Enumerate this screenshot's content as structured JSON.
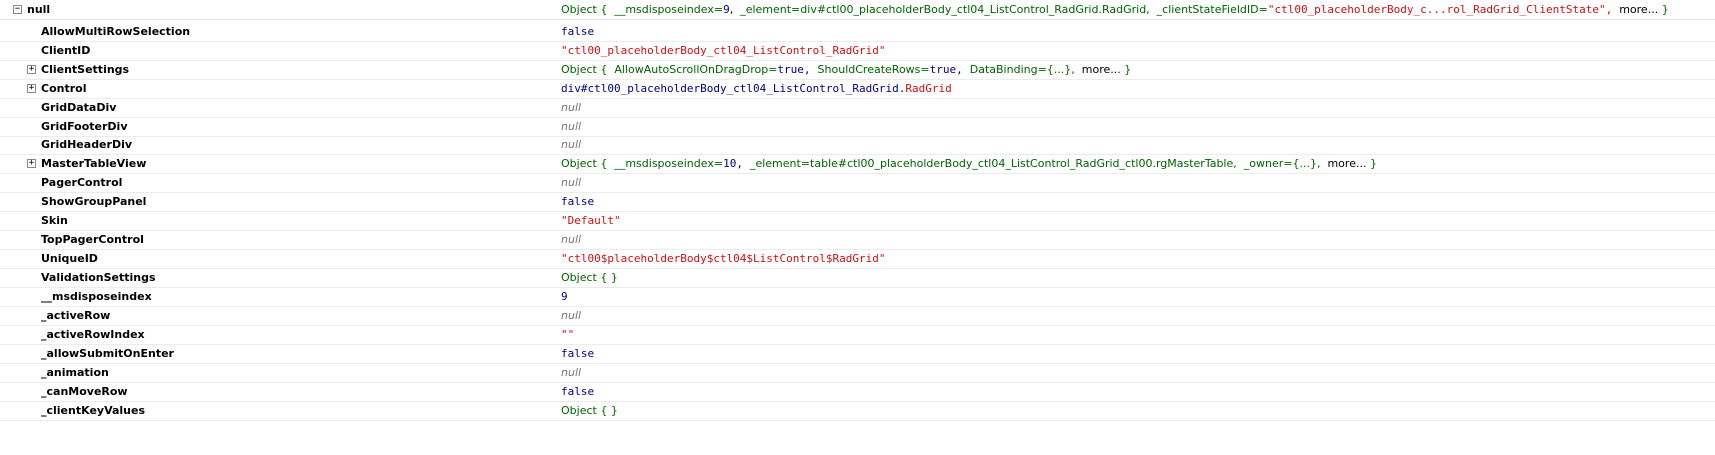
{
  "root": {
    "key": "null",
    "value": {
      "obj": "Object {",
      "p1": "__msdisposeindex=",
      "p1v": "9",
      "p2": "_element=div#ctl00_placeholderBody_ctl04_ListControl_RadGrid.RadGrid,",
      "p3": "_clientStateFieldID=",
      "p3v": "\"ctl00_placeholderBody_c...rol_RadGrid_ClientState\",",
      "more": "more...",
      "close": "}"
    }
  },
  "rows": [
    {
      "key": "AllowMultiRowSelection",
      "value": "false"
    },
    {
      "key": "ClientID",
      "value": "\"ctl00_placeholderBody_ctl04_ListControl_RadGrid\""
    },
    {
      "key": "ClientSettings",
      "value": {
        "obj": "Object {",
        "p1": "AllowAutoScrollOnDragDrop=",
        "p1v": "true,",
        "p2": "ShouldCreateRows=",
        "p2v": "true,",
        "p3": "DataBinding={...},",
        "more": "more...",
        "close": "}"
      }
    },
    {
      "key": "Control",
      "value": {
        "el": "div#ctl00_placeholderBody_ctl04_ListControl_RadGrid.",
        "cls": "RadGrid"
      }
    },
    {
      "key": "GridDataDiv",
      "value": "null"
    },
    {
      "key": "GridFooterDiv",
      "value": "null"
    },
    {
      "key": "GridHeaderDiv",
      "value": "null"
    },
    {
      "key": "MasterTableView",
      "value": {
        "obj": "Object {",
        "p1": "__msdisposeindex=",
        "p1v": "10,",
        "p2": "_element=table#ctl00_placeholderBody_ctl04_ListControl_RadGrid_ctl00.rgMasterTable,",
        "p3": "_owner={...},",
        "more": "more...",
        "close": "}"
      }
    },
    {
      "key": "PagerControl",
      "value": "null"
    },
    {
      "key": "ShowGroupPanel",
      "value": "false"
    },
    {
      "key": "Skin",
      "value": "\"Default\""
    },
    {
      "key": "TopPagerControl",
      "value": "null"
    },
    {
      "key": "UniqueID",
      "value": "\"ctl00$placeholderBody$ctl04$ListControl$RadGrid\""
    },
    {
      "key": "ValidationSettings",
      "value": "Object {  }"
    },
    {
      "key": "__msdisposeindex",
      "value": "9"
    },
    {
      "key": "_activeRow",
      "value": "null"
    },
    {
      "key": "_activeRowIndex",
      "value": "\"\""
    },
    {
      "key": "_allowSubmitOnEnter",
      "value": "false"
    },
    {
      "key": "_animation",
      "value": "null"
    },
    {
      "key": "_canMoveRow",
      "value": "false"
    },
    {
      "key": "_clientKeyValues",
      "value": "Object {  }"
    }
  ],
  "icons": {
    "expand": "plus-box",
    "collapse": "minus-box"
  },
  "colors": {
    "object": "#006400",
    "keyword": "#000080",
    "string": "#cc1111",
    "null": "#777777"
  }
}
